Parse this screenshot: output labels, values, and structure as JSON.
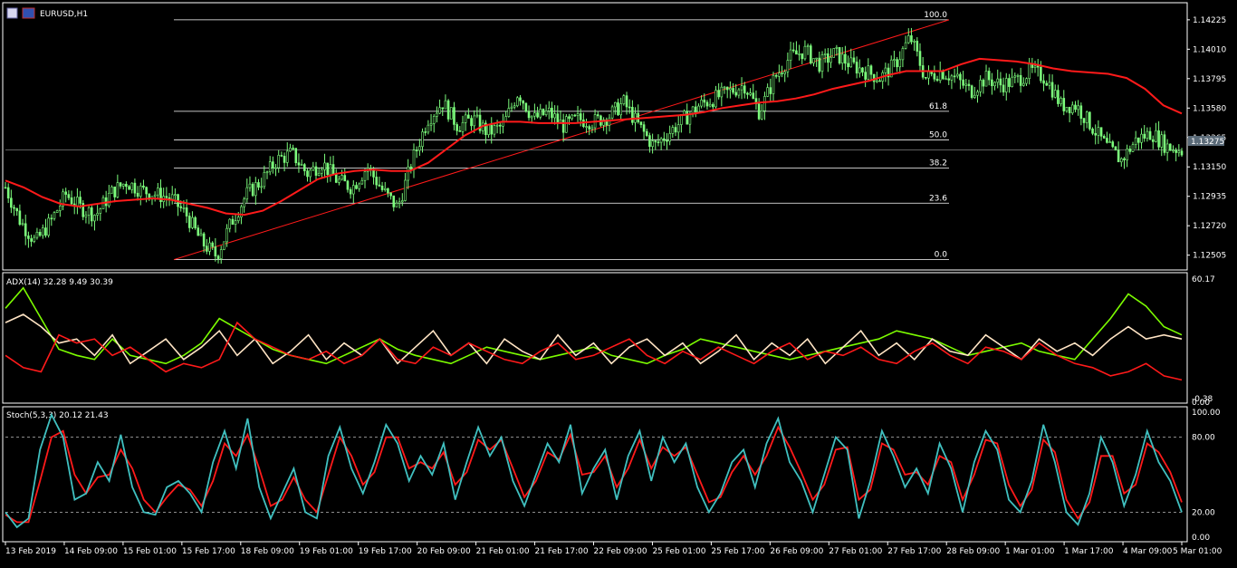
{
  "symbol_label": "EURUSD,H1",
  "colors": {
    "background": "#000000",
    "grid": "#ffffff",
    "candle_up": "#7cfc7c",
    "ma": "#ff1a1a",
    "adx_main": "#7cfc00",
    "adx_plus": "#ffe4c4",
    "adx_minus": "#ff1a1a",
    "stoch_main": "#40c0c0",
    "stoch_signal": "#ff1a1a",
    "current_price_box": "#5a6a78"
  },
  "price_panel": {
    "fib_levels": [
      {
        "label": "100.0",
        "price": 1.14225
      },
      {
        "label": "61.8",
        "price": 1.13556
      },
      {
        "label": "50.0",
        "price": 1.13348
      },
      {
        "label": "38.2",
        "price": 1.13141
      },
      {
        "label": "23.6",
        "price": 1.12885
      },
      {
        "label": "0.0",
        "price": 1.12472
      }
    ],
    "current_price": "1.13275"
  },
  "adx_panel": {
    "header": "ADX(14) 32.28 9.49 30.39",
    "top_label": "60.17",
    "bottom_label": "0.00",
    "overlap_label": "-0.38"
  },
  "stoch_panel": {
    "header": "Stoch(5,3,3) 20.12 21.43"
  },
  "chart_data": [
    {
      "type": "candlestick",
      "title": "EURUSD,H1",
      "ylim": [
        1.1241,
        1.1433
      ],
      "y_ticks": [
        "1.14225",
        "1.14010",
        "1.13795",
        "1.13580",
        "1.13365",
        "1.13150",
        "1.12935",
        "1.12720",
        "1.12505"
      ],
      "x_ticks": [
        "13 Feb 2019",
        "14 Feb 09:00",
        "15 Feb 01:00",
        "15 Feb 17:00",
        "18 Feb 09:00",
        "19 Feb 01:00",
        "19 Feb 17:00",
        "20 Feb 09:00",
        "21 Feb 01:00",
        "21 Feb 17:00",
        "22 Feb 09:00",
        "25 Feb 01:00",
        "25 Feb 17:00",
        "26 Feb 09:00",
        "27 Feb 01:00",
        "27 Feb 17:00",
        "28 Feb 09:00",
        "1 Mar 01:00",
        "1 Mar 17:00",
        "4 Mar 09:00",
        "5 Mar 01:00"
      ],
      "close_trace": [
        1.13,
        1.1275,
        1.126,
        1.1275,
        1.1295,
        1.1285,
        1.128,
        1.1296,
        1.1304,
        1.1298,
        1.1295,
        1.1292,
        1.128,
        1.126,
        1.125,
        1.1275,
        1.1295,
        1.1305,
        1.132,
        1.1325,
        1.131,
        1.1318,
        1.1305,
        1.13,
        1.1315,
        1.1298,
        1.1285,
        1.132,
        1.135,
        1.1362,
        1.1345,
        1.135,
        1.134,
        1.1345,
        1.137,
        1.135,
        1.1355,
        1.1345,
        1.135,
        1.1348,
        1.1352,
        1.1362,
        1.1345,
        1.133,
        1.134,
        1.135,
        1.136,
        1.1365,
        1.137,
        1.1375,
        1.1355,
        1.138,
        1.1395,
        1.14,
        1.139,
        1.1398,
        1.139,
        1.1385,
        1.138,
        1.139,
        1.141,
        1.138,
        1.1385,
        1.138,
        1.137,
        1.138,
        1.1375,
        1.1378,
        1.1385,
        1.138,
        1.136,
        1.136,
        1.1345,
        1.133,
        1.132,
        1.1335,
        1.134,
        1.133,
        1.1327
      ],
      "ma_trace": [
        1.1305,
        1.13,
        1.1293,
        1.1288,
        1.1286,
        1.1288,
        1.129,
        1.1291,
        1.1292,
        1.1291,
        1.1288,
        1.1285,
        1.1281,
        1.128,
        1.1283,
        1.129,
        1.1298,
        1.1306,
        1.131,
        1.1312,
        1.1313,
        1.1312,
        1.1312,
        1.1318,
        1.1328,
        1.1338,
        1.1345,
        1.1348,
        1.1348,
        1.1347,
        1.1347,
        1.1347,
        1.1348,
        1.1349,
        1.135,
        1.1351,
        1.1352,
        1.1353,
        1.1355,
        1.1358,
        1.136,
        1.1362,
        1.1363,
        1.1365,
        1.1368,
        1.1372,
        1.1375,
        1.1378,
        1.1382,
        1.1385,
        1.1385,
        1.1385,
        1.139,
        1.1394,
        1.1393,
        1.1392,
        1.139,
        1.1387,
        1.1385,
        1.1384,
        1.1383,
        1.138,
        1.1372,
        1.136,
        1.1354
      ],
      "series": [
        {
          "name": "Fibonacci trendline",
          "x": [
            0.0,
            1.0
          ],
          "y": [
            1.12472,
            1.14225
          ]
        }
      ]
    },
    {
      "type": "line",
      "title": "ADX(14) 32.28 9.49 30.39",
      "ylim": [
        0,
        60.17
      ],
      "series": [
        {
          "name": "ADX",
          "values": [
            45,
            55,
            40,
            25,
            22,
            20,
            30,
            22,
            20,
            18,
            22,
            28,
            40,
            35,
            30,
            25,
            22,
            20,
            18,
            22,
            26,
            30,
            25,
            22,
            20,
            18,
            22,
            26,
            24,
            22,
            20,
            22,
            24,
            26,
            22,
            20,
            18,
            22,
            25,
            30,
            28,
            26,
            24,
            22,
            20,
            22,
            24,
            26,
            28,
            30,
            34,
            32,
            30,
            26,
            22,
            24,
            26,
            28,
            24,
            22,
            20,
            30,
            40,
            52,
            46,
            36,
            32
          ]
        },
        {
          "name": "+DI",
          "values": [
            38,
            42,
            36,
            28,
            30,
            22,
            32,
            18,
            24,
            30,
            20,
            26,
            34,
            22,
            30,
            18,
            24,
            32,
            20,
            28,
            22,
            30,
            18,
            26,
            34,
            22,
            28,
            18,
            30,
            24,
            20,
            32,
            22,
            28,
            18,
            26,
            30,
            22,
            28,
            18,
            24,
            32,
            20,
            28,
            22,
            30,
            18,
            26,
            34,
            22,
            28,
            20,
            30,
            24,
            22,
            32,
            26,
            20,
            30,
            24,
            28,
            22,
            30,
            36,
            30,
            32,
            30
          ]
        },
        {
          "name": "-DI",
          "values": [
            22,
            16,
            14,
            32,
            28,
            30,
            22,
            26,
            20,
            14,
            18,
            16,
            20,
            38,
            30,
            26,
            22,
            20,
            24,
            18,
            22,
            30,
            20,
            18,
            26,
            22,
            28,
            24,
            20,
            18,
            24,
            28,
            20,
            22,
            26,
            30,
            22,
            18,
            24,
            20,
            26,
            22,
            18,
            24,
            28,
            20,
            24,
            22,
            26,
            20,
            18,
            24,
            28,
            22,
            18,
            26,
            24,
            20,
            28,
            22,
            18,
            16,
            12,
            14,
            18,
            12,
            10
          ]
        }
      ]
    },
    {
      "type": "line",
      "title": "Stoch(5,3,3) 20.12 21.43",
      "ylim": [
        0,
        100
      ],
      "y_ticks": [
        "100.00",
        "80.00",
        "20.00",
        "0.00"
      ],
      "series": [
        {
          "name": "Main",
          "values": [
            20,
            8,
            15,
            70,
            98,
            80,
            30,
            35,
            60,
            45,
            82,
            40,
            20,
            18,
            40,
            45,
            35,
            20,
            60,
            85,
            55,
            95,
            40,
            15,
            35,
            55,
            20,
            15,
            65,
            88,
            55,
            35,
            60,
            90,
            75,
            45,
            65,
            50,
            75,
            30,
            60,
            88,
            65,
            80,
            45,
            25,
            50,
            75,
            60,
            90,
            35,
            55,
            70,
            30,
            65,
            85,
            45,
            80,
            60,
            75,
            40,
            20,
            35,
            60,
            70,
            40,
            75,
            95,
            60,
            45,
            20,
            50,
            80,
            70,
            15,
            45,
            85,
            65,
            40,
            55,
            35,
            75,
            55,
            20,
            60,
            85,
            70,
            30,
            20,
            45,
            90,
            60,
            20,
            10,
            35,
            80,
            60,
            25,
            50,
            85,
            60,
            45,
            20
          ]
        },
        {
          "name": "Signal",
          "values": [
            18,
            12,
            12,
            45,
            80,
            85,
            50,
            35,
            48,
            50,
            70,
            55,
            30,
            20,
            32,
            42,
            38,
            25,
            45,
            75,
            65,
            82,
            55,
            25,
            30,
            48,
            30,
            20,
            50,
            80,
            65,
            42,
            52,
            80,
            80,
            55,
            60,
            55,
            68,
            42,
            52,
            78,
            70,
            78,
            55,
            32,
            45,
            68,
            62,
            82,
            50,
            52,
            65,
            40,
            55,
            78,
            55,
            72,
            65,
            72,
            50,
            28,
            32,
            52,
            65,
            50,
            65,
            88,
            72,
            52,
            30,
            42,
            70,
            72,
            30,
            38,
            75,
            70,
            50,
            52,
            42,
            65,
            60,
            30,
            50,
            78,
            75,
            42,
            25,
            38,
            78,
            68,
            30,
            15,
            28,
            65,
            65,
            35,
            42,
            75,
            68,
            52,
            28
          ]
        }
      ]
    }
  ]
}
